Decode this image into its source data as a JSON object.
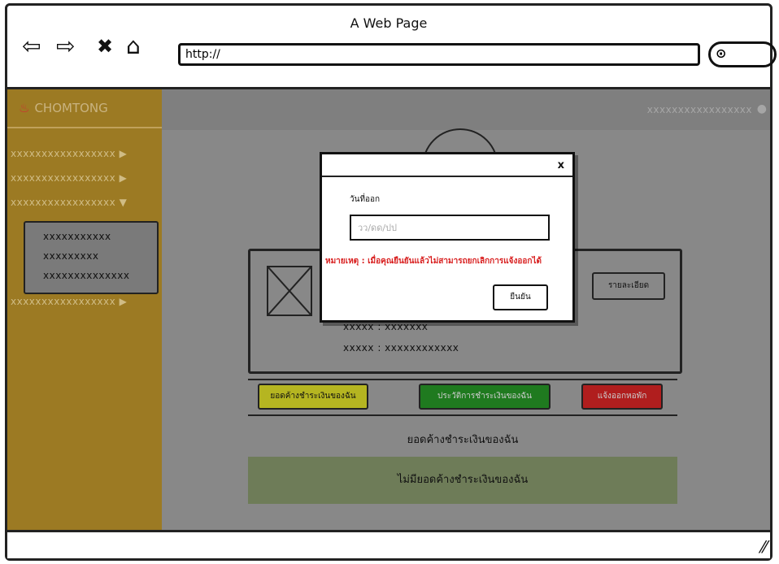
{
  "window": {
    "title": "A Web Page",
    "url": "http://",
    "nav_icons": [
      "back-arrow-icon",
      "forward-arrow-icon",
      "close-x-icon",
      "home-icon"
    ]
  },
  "sidebar": {
    "brand": "CHOMTONG",
    "items": [
      {
        "label": "xxxxxxxxxxxxxxxxx",
        "arrow": "▶"
      },
      {
        "label": "xxxxxxxxxxxxxxxxx",
        "arrow": "▶"
      },
      {
        "label": "xxxxxxxxxxxxxxxxx",
        "arrow": "▼"
      },
      {
        "label": "xxxxxxxxxxxxxxxxx",
        "arrow": "▶"
      }
    ],
    "submenu": [
      "xxxxxxxxxxx",
      "xxxxxxxxx",
      "xxxxxxxxxxxxxx"
    ]
  },
  "header": {
    "user": "xxxxxxxxxxxxxxxxx"
  },
  "card": {
    "detail_button": "รายละเอียด",
    "lines": [
      "xxxxx : xxxxxxx",
      "xxxxx : xxxxxxxxxxxx"
    ]
  },
  "actions": [
    {
      "label": "ยอดค้างชำระเงินของฉัน",
      "color": "#b5b521"
    },
    {
      "label": "ประวัติการชำระเงินของฉัน",
      "color": "#1f7a1f"
    },
    {
      "label": "แจ้งออกหอพัก",
      "color": "#b01e1e"
    }
  ],
  "outstanding": {
    "title": "ยอดค้างชำระเงินของฉัน",
    "empty_message": "ไม่มียอดค้างชำระเงินของฉัน"
  },
  "modal": {
    "close": "x",
    "label": "วันที่ออก",
    "date_placeholder": "วว/ดด/ปป",
    "note": "หมายเหตุ : เมื่อคุณยืนยันแล้วไม่สามารถยกเลิกการแจ้งออกได้",
    "confirm": "ยืนยัน"
  }
}
